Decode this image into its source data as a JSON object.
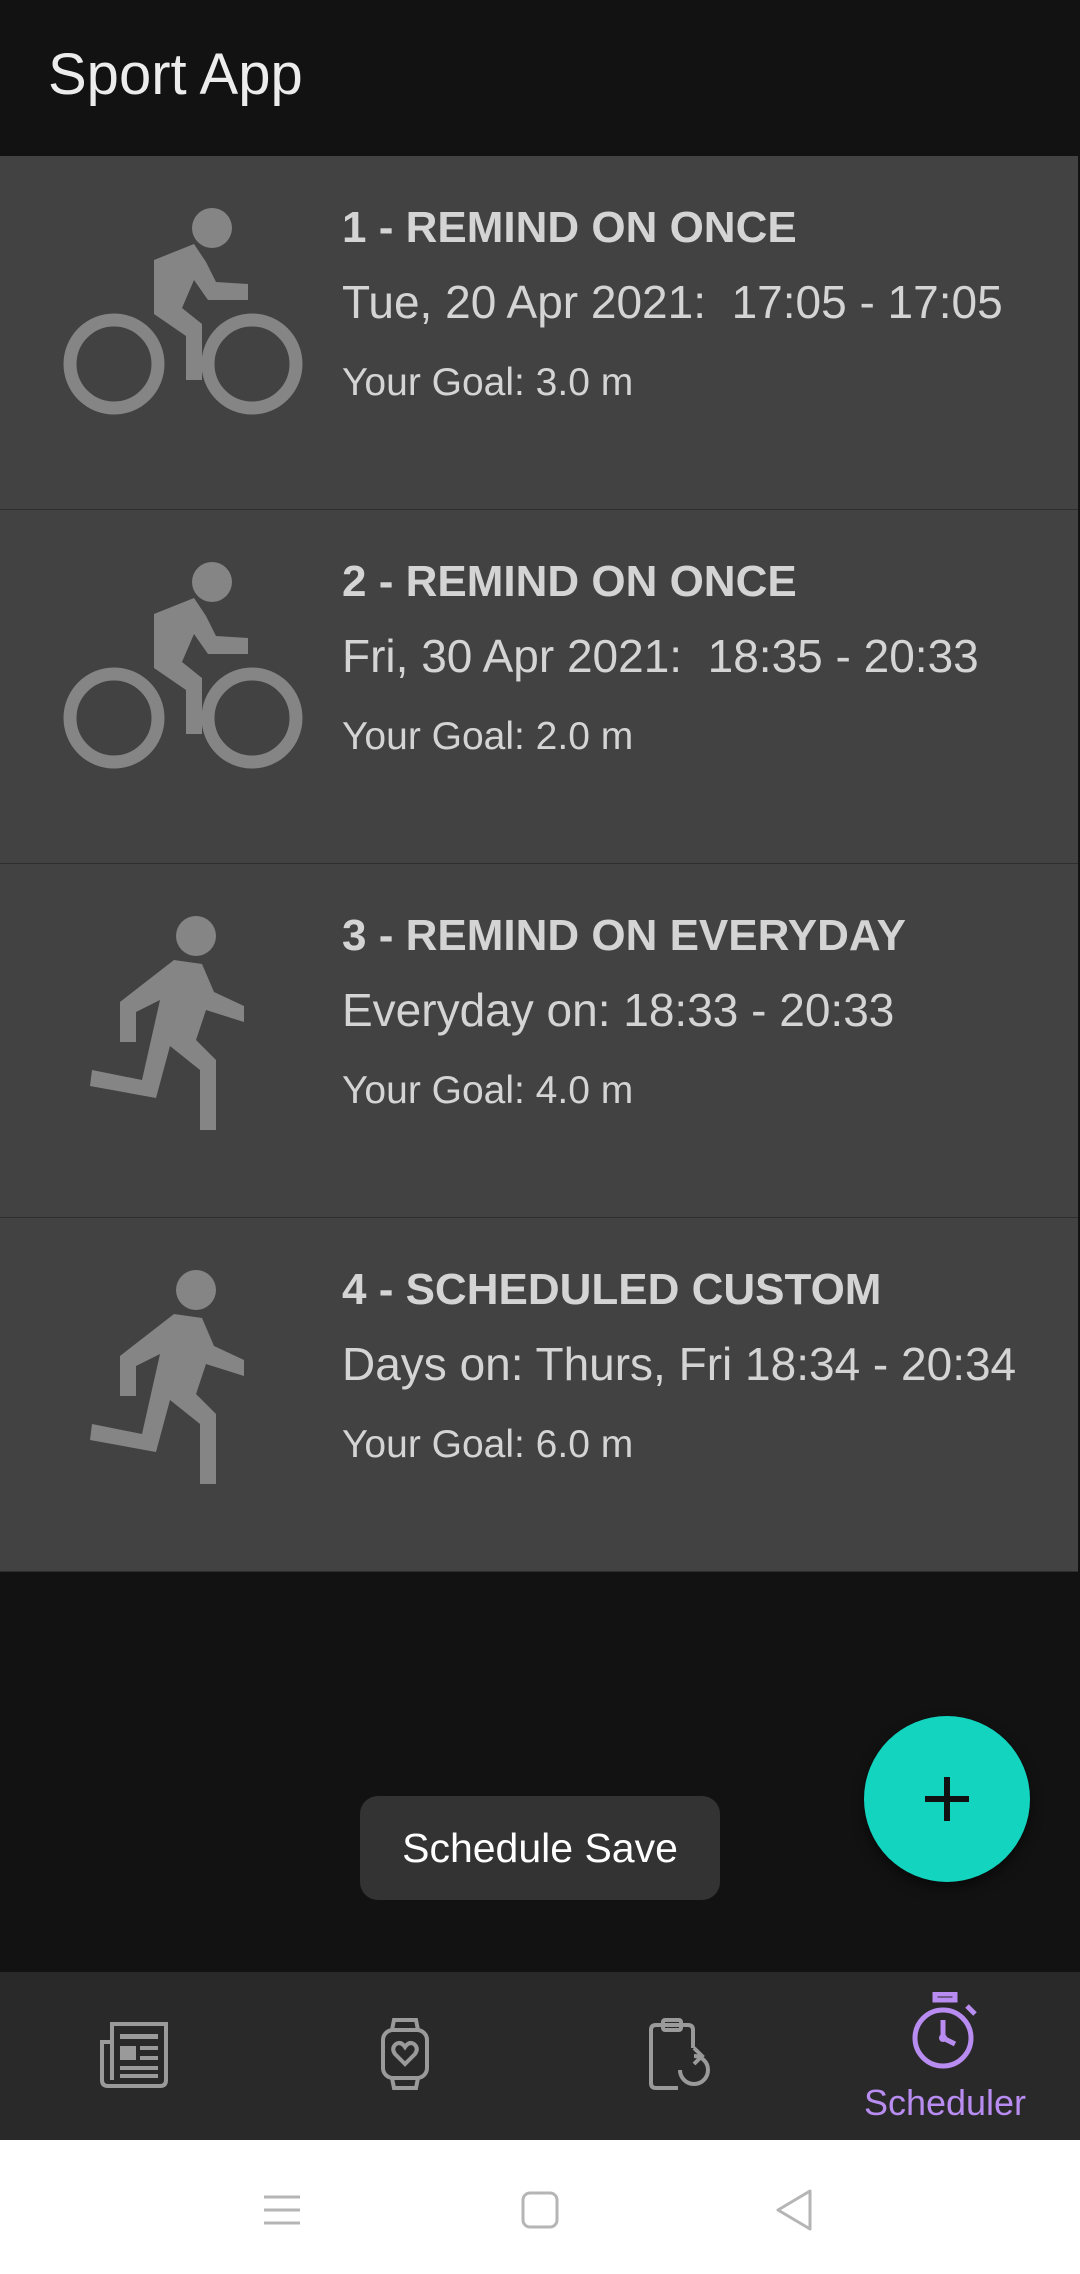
{
  "app": {
    "title": "Sport App"
  },
  "schedules": [
    {
      "icon": "bike-icon",
      "title": "1 - REMIND ON ONCE",
      "time": "Tue, 20 Apr 2021:  17:05 - 17:05",
      "goal": "Your Goal: 3.0 m"
    },
    {
      "icon": "bike-icon",
      "title": "2 - REMIND ON ONCE",
      "time": "Fri, 30 Apr 2021:  18:35 - 20:33",
      "goal": "Your Goal: 2.0 m"
    },
    {
      "icon": "run-icon",
      "title": "3 - REMIND ON EVERYDAY",
      "time": "Everyday on: 18:33 - 20:33",
      "goal": "Your Goal: 4.0 m"
    },
    {
      "icon": "run-icon",
      "title": "4 - SCHEDULED CUSTOM",
      "time": "Days on: Thurs, Fri 18:34 - 20:34",
      "goal": "Your Goal: 6.0 m"
    }
  ],
  "fab": {
    "icon": "plus-icon"
  },
  "toast": {
    "text": "Schedule Save"
  },
  "bottom_nav": {
    "items": [
      {
        "icon": "news-icon",
        "label": ""
      },
      {
        "icon": "watch-heart-icon",
        "label": ""
      },
      {
        "icon": "clipboard-refresh-icon",
        "label": ""
      },
      {
        "icon": "timer-icon",
        "label": "Scheduler",
        "active": true
      }
    ]
  },
  "system_nav": {
    "icons": [
      "menu-icon",
      "home-icon",
      "back-icon"
    ]
  },
  "colors": {
    "background": "#121212",
    "card": "#424242",
    "accent_fab": "#12d4bf",
    "active_nav": "#b88cf0",
    "icon_gray": "#858585"
  }
}
